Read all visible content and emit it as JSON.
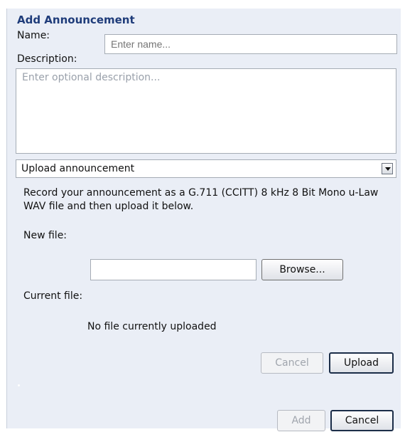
{
  "dialog": {
    "title": "Add Announcement",
    "name_label": "Name:",
    "name_placeholder": "Enter name...",
    "description_label": "Description:",
    "description_placeholder": "Enter optional description...",
    "mode_select_value": "Upload announcement",
    "info_text": "Record your announcement as a G.711 (CCITT) 8 kHz 8 Bit Mono u-Law WAV file and then upload it below.",
    "new_file_label": "New file:",
    "file_input_value": "",
    "browse_label": "Browse...",
    "current_file_label": "Current file:",
    "current_file_status": "No file currently uploaded",
    "upload_cancel_label": "Cancel",
    "upload_label": "Upload",
    "add_label": "Add",
    "cancel_label": "Cancel"
  },
  "colors": {
    "title": "#1f3c7a",
    "panel_background": "#eaeef6",
    "placeholder_text": "#9aa1ab",
    "disabled_text": "#a0a5ad"
  },
  "icons": {
    "select_arrow": "chevron-down-icon"
  }
}
